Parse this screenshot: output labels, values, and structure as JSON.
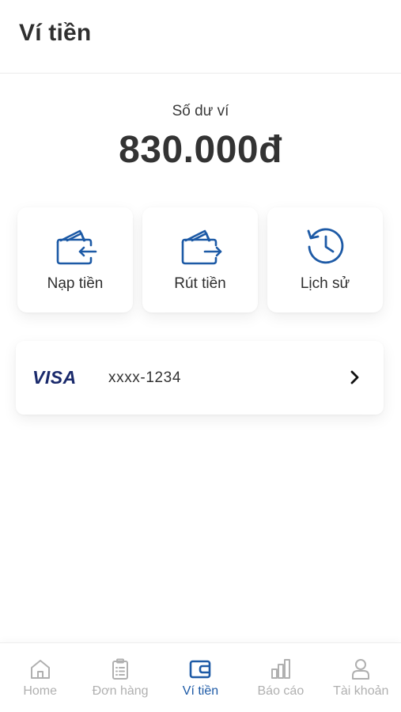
{
  "header": {
    "title": "Ví tiền"
  },
  "balance": {
    "label": "Số dư ví",
    "amount": "830.000đ"
  },
  "actions": [
    {
      "label": "Nạp tiền",
      "icon": "wallet-in-icon"
    },
    {
      "label": "Rút tiền",
      "icon": "wallet-out-icon"
    },
    {
      "label": "Lịch sử",
      "icon": "history-icon"
    }
  ],
  "card": {
    "brand": "VISA",
    "number": "xxxx-1234",
    "icon": "chevron-right-icon"
  },
  "tabs": [
    {
      "label": "Home",
      "icon": "home-icon",
      "active": false
    },
    {
      "label": "Đơn hàng",
      "icon": "clipboard-icon",
      "active": false
    },
    {
      "label": "Ví tiền",
      "icon": "wallet-icon",
      "active": true
    },
    {
      "label": "Báo cáo",
      "icon": "bar-chart-icon",
      "active": false
    },
    {
      "label": "Tài khoản",
      "icon": "user-icon",
      "active": false
    }
  ],
  "colors": {
    "accent": "#1d5aa6",
    "inactive": "#b0b0b0",
    "visa": "#1a2a6c"
  }
}
